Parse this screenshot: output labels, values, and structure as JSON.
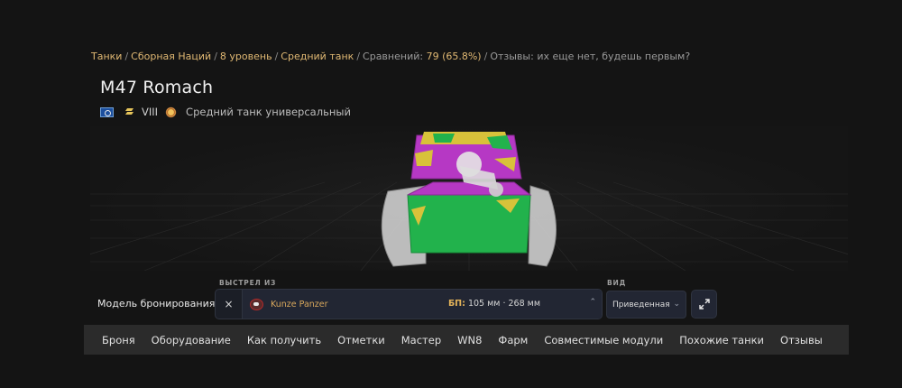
{
  "breadcrumb": {
    "tanks": "Танки",
    "nation": "Сборная Наций",
    "tier": "8 уровень",
    "type": "Средний танк",
    "compared_label": "Сравнений:",
    "compared_value": "79 (65.8%)",
    "reviews_label": "Отзывы:",
    "reviews_value": "их еще нет, будешь первым?"
  },
  "tank": {
    "name": "M47 Romach",
    "tier": "VIII",
    "role": "Средний танк универсальный",
    "icons": [
      "nation-flag-icon",
      "rank-chevron-icon",
      "role-gear-icon"
    ]
  },
  "armor_panel": {
    "title": "Модель бронирования",
    "shot_caption": "ВЫСТРЕЛ ИЗ",
    "clear_symbol": "×",
    "shell_name": "Kunze Panzer",
    "pen_label": "БП:",
    "pen_values": "105 мм · 268 мм",
    "view_caption": "ВИД",
    "view_value": "Приведенная",
    "caret": "⌃",
    "view_caret": "⌄"
  },
  "tabs": [
    "Броня",
    "Оборудование",
    "Как получить",
    "Отметки",
    "Мастер",
    "WN8",
    "Фарм",
    "Совместимые модули",
    "Похожие танки",
    "Отзывы"
  ],
  "colors": {
    "accent": "#e0b873",
    "background": "#141414",
    "tab_bar": "#2b2b2b",
    "armor_green": "#22b24c",
    "armor_magenta": "#b638c4",
    "armor_yellow": "#d8c23a"
  }
}
